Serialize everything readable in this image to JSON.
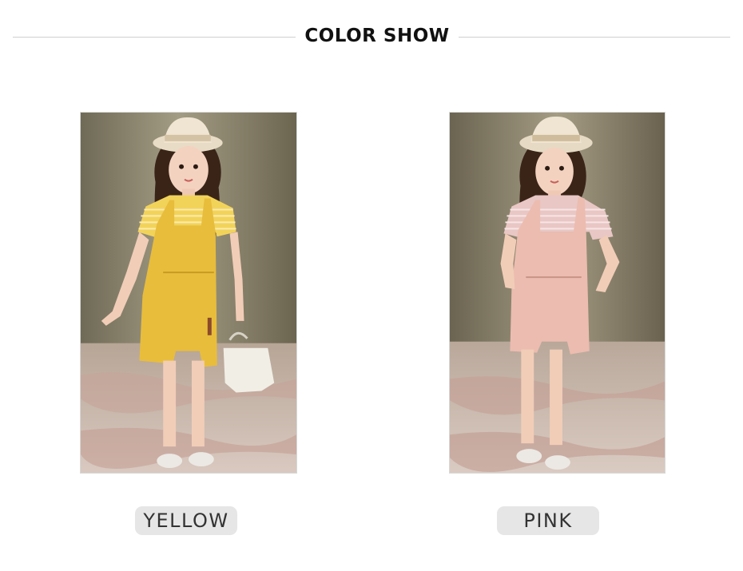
{
  "section_title": "COLOR SHOW",
  "variants": [
    {
      "label": "YELLOW",
      "overall_color": "#e8bd3c",
      "tee_color": "#f2d35a",
      "stripe_color": "#fbeab0"
    },
    {
      "label": "PINK",
      "overall_color": "#ecbcb0",
      "tee_color": "#e9c7c4",
      "stripe_color": "#f6e6e6"
    }
  ],
  "colors": {
    "background": "#ffffff",
    "rule": "#cfcfcf",
    "label_bg": "#e6e6e6",
    "title": "#111111"
  }
}
